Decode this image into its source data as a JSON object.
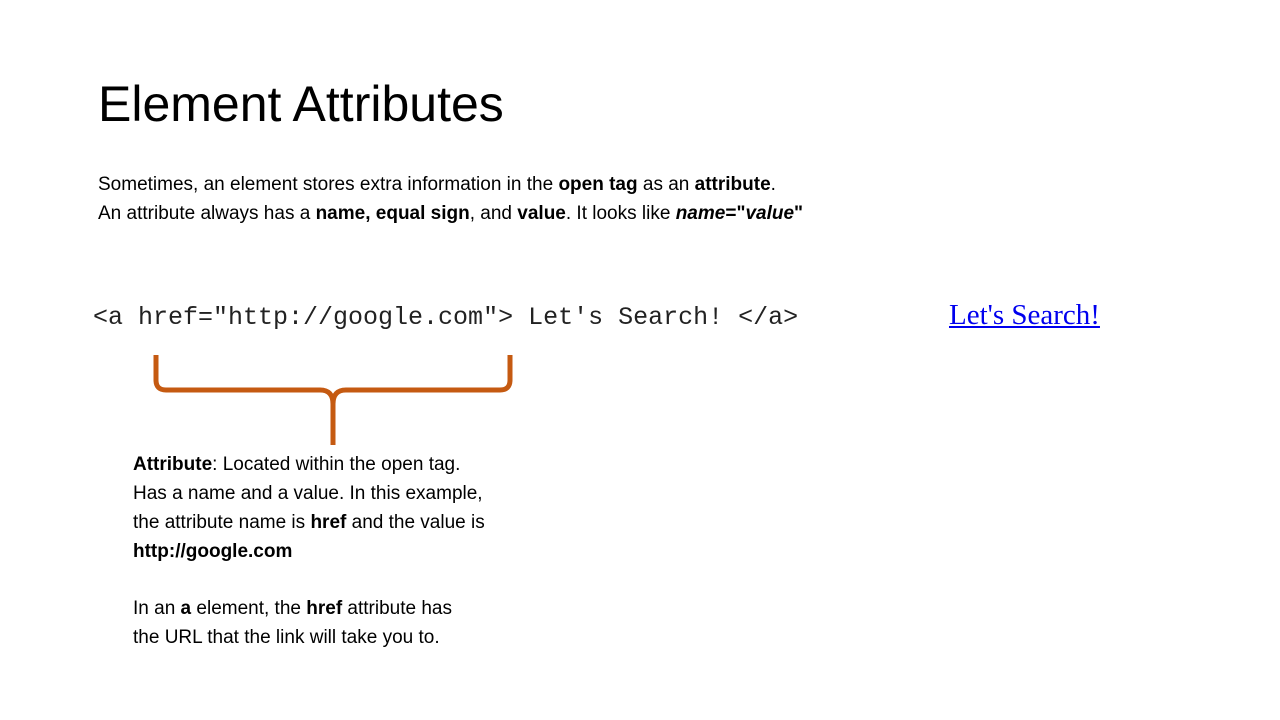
{
  "slide": {
    "title": "Element Attributes",
    "intro": {
      "line1": {
        "t1": "Sometimes, an element stores extra information in the ",
        "b1": "open tag",
        "t2": " as an ",
        "b2": "attribute",
        "t3": "."
      },
      "line2": {
        "t1": "An attribute always has a ",
        "b1": "name, equal sign",
        "t2": ", and ",
        "b2": "value",
        "t3": ". It looks like ",
        "bi1": "name",
        "b3": "=\"",
        "bi2": "value",
        "b4": "\""
      }
    },
    "code_example": "<a href=\"http://google.com\"> Let's Search! </a>",
    "rendered_link": "Let's Search!",
    "note": {
      "term": "Attribute",
      "line1_rest": ": Located within the open tag.",
      "line2": "Has a name and a value. In this example,",
      "line3_t1": "the attribute name is ",
      "line3_b1": "href",
      "line3_t2": " and the value is",
      "line4_b": "http://google.com",
      "line5_t1": "In an ",
      "line5_b1": "a",
      "line5_t2": " element, the ",
      "line5_b2": "href",
      "line5_t3": " attribute has",
      "line6": "the URL that the link will take you to."
    },
    "colors": {
      "brace": "#c55a11",
      "link": "#0000ee"
    }
  }
}
